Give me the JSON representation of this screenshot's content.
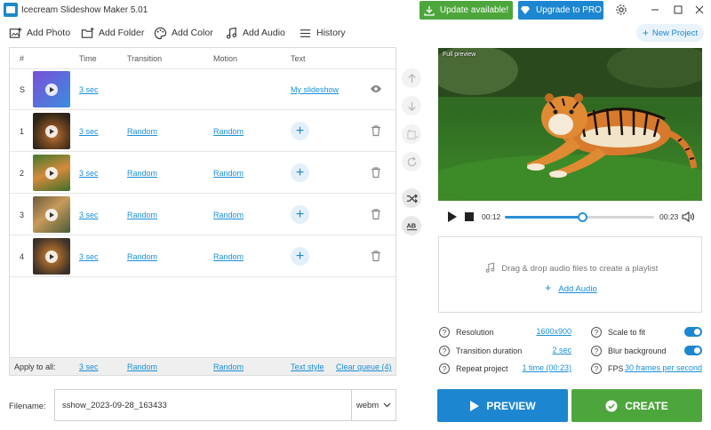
{
  "window": {
    "title": "Icecream Slideshow Maker 5.01"
  },
  "topbar": {
    "update_label": "Update available!",
    "pro_label": "Upgrade to PRO"
  },
  "toolbar": {
    "add_photo": "Add Photo",
    "add_folder": "Add Folder",
    "add_color": "Add Color",
    "add_audio": "Add Audio",
    "history": "History",
    "new_project": "New Project"
  },
  "table": {
    "headers": {
      "index": "#",
      "time": "Time",
      "transition": "Transition",
      "motion": "Motion",
      "text": "Text"
    },
    "start_row": {
      "index": "S",
      "time": "3 sec",
      "text": "My slideshow"
    },
    "rows": [
      {
        "index": "1",
        "time": "3 sec",
        "transition": "Random",
        "motion": "Random"
      },
      {
        "index": "2",
        "time": "3 sec",
        "transition": "Random",
        "motion": "Random"
      },
      {
        "index": "3",
        "time": "3 sec",
        "transition": "Random",
        "motion": "Random"
      },
      {
        "index": "4",
        "time": "3 sec",
        "transition": "Random",
        "motion": "Random"
      }
    ],
    "apply_all": {
      "label": "Apply to all:",
      "time": "3 sec",
      "transition": "Random",
      "motion": "Random",
      "text_style": "Text style",
      "clear_queue": "Clear queue (4)"
    }
  },
  "preview": {
    "label": "Full preview",
    "current_time": "00:12",
    "total_time": "00:23",
    "progress": 0.52
  },
  "audio": {
    "drop_text": "Drag & drop audio files to create a playlist",
    "add_label": "Add Audio"
  },
  "settings": {
    "resolution_label": "Resolution",
    "resolution_value": "1600x900",
    "transition_label": "Transition duration",
    "transition_value": "2 sec",
    "repeat_label": "Repeat project",
    "repeat_value": "1 time (00:23)",
    "scale_label": "Scale to fit",
    "scale_on": true,
    "blur_label": "Blur background",
    "blur_on": true,
    "fps_label": "FPS",
    "fps_value": "30 frames per second"
  },
  "output": {
    "filename_label": "Filename:",
    "filename_value": "sshow_2023-09-28_163433",
    "format": "webm",
    "preview_button": "PREVIEW",
    "create_button": "CREATE"
  },
  "colors": {
    "accent_blue": "#1d86d0",
    "accent_green": "#4da63c",
    "link": "#1a8fd6"
  }
}
